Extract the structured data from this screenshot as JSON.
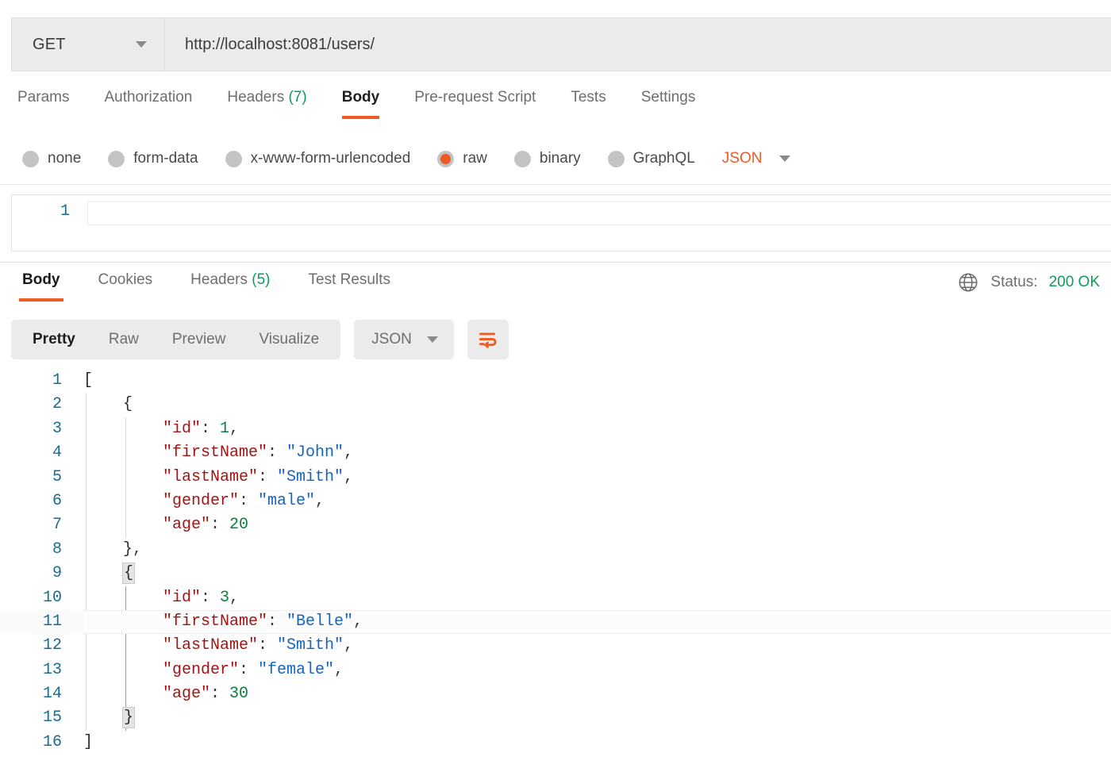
{
  "request": {
    "method": "GET",
    "method_caret_icon": "chevron-down-icon",
    "url": "http://localhost:8081/users/",
    "tabs": [
      {
        "label": "Params",
        "active": false
      },
      {
        "label": "Authorization",
        "active": false
      },
      {
        "label": "Headers",
        "count": "(7)",
        "active": false
      },
      {
        "label": "Body",
        "active": true
      },
      {
        "label": "Pre-request Script",
        "active": false
      },
      {
        "label": "Tests",
        "active": false
      },
      {
        "label": "Settings",
        "active": false
      }
    ],
    "body_types": [
      {
        "label": "none",
        "checked": false
      },
      {
        "label": "form-data",
        "checked": false
      },
      {
        "label": "x-www-form-urlencoded",
        "checked": false
      },
      {
        "label": "raw",
        "checked": true
      },
      {
        "label": "binary",
        "checked": false
      },
      {
        "label": "GraphQL",
        "checked": false
      }
    ],
    "raw_format": "JSON",
    "raw_format_caret_icon": "chevron-down-icon",
    "editor": {
      "line_number": "1",
      "value": "",
      "placeholder": ""
    }
  },
  "response": {
    "tabs": [
      {
        "label": "Body",
        "active": true
      },
      {
        "label": "Cookies",
        "active": false
      },
      {
        "label": "Headers",
        "count": "(5)",
        "active": false
      },
      {
        "label": "Test Results",
        "active": false
      }
    ],
    "globe_icon": "globe-icon",
    "status_label": "Status:",
    "status_value": "200 OK",
    "toolbar": {
      "views": [
        {
          "label": "Pretty",
          "active": true
        },
        {
          "label": "Raw",
          "active": false
        },
        {
          "label": "Preview",
          "active": false
        },
        {
          "label": "Visualize",
          "active": false
        }
      ],
      "format": "JSON",
      "format_caret_icon": "chevron-down-icon",
      "wrap_icon": "word-wrap-icon"
    },
    "body_lines": [
      {
        "n": "1",
        "indent": 0,
        "tokens": [
          {
            "t": "brace",
            "v": "["
          }
        ]
      },
      {
        "n": "2",
        "indent": 1,
        "tokens": [
          {
            "t": "brace",
            "v": "{"
          }
        ]
      },
      {
        "n": "3",
        "indent": 2,
        "tokens": [
          {
            "t": "key",
            "v": "\"id\""
          },
          {
            "t": "punc",
            "v": ": "
          },
          {
            "t": "num",
            "v": "1"
          },
          {
            "t": "punc",
            "v": ","
          }
        ]
      },
      {
        "n": "4",
        "indent": 2,
        "tokens": [
          {
            "t": "key",
            "v": "\"firstName\""
          },
          {
            "t": "punc",
            "v": ": "
          },
          {
            "t": "str",
            "v": "\"John\""
          },
          {
            "t": "punc",
            "v": ","
          }
        ]
      },
      {
        "n": "5",
        "indent": 2,
        "tokens": [
          {
            "t": "key",
            "v": "\"lastName\""
          },
          {
            "t": "punc",
            "v": ": "
          },
          {
            "t": "str",
            "v": "\"Smith\""
          },
          {
            "t": "punc",
            "v": ","
          }
        ]
      },
      {
        "n": "6",
        "indent": 2,
        "tokens": [
          {
            "t": "key",
            "v": "\"gender\""
          },
          {
            "t": "punc",
            "v": ": "
          },
          {
            "t": "str",
            "v": "\"male\""
          },
          {
            "t": "punc",
            "v": ","
          }
        ]
      },
      {
        "n": "7",
        "indent": 2,
        "tokens": [
          {
            "t": "key",
            "v": "\"age\""
          },
          {
            "t": "punc",
            "v": ": "
          },
          {
            "t": "num",
            "v": "20"
          }
        ]
      },
      {
        "n": "8",
        "indent": 1,
        "tokens": [
          {
            "t": "brace",
            "v": "}"
          },
          {
            "t": "punc",
            "v": ","
          }
        ]
      },
      {
        "n": "9",
        "indent": 1,
        "tokens": [
          {
            "t": "brace-match",
            "v": "{"
          }
        ]
      },
      {
        "n": "10",
        "indent": 2,
        "tokens": [
          {
            "t": "key",
            "v": "\"id\""
          },
          {
            "t": "punc",
            "v": ": "
          },
          {
            "t": "num",
            "v": "3"
          },
          {
            "t": "punc",
            "v": ","
          }
        ]
      },
      {
        "n": "11",
        "indent": 2,
        "active": true,
        "tokens": [
          {
            "t": "key",
            "v": "\"firstName\""
          },
          {
            "t": "punc",
            "v": ": "
          },
          {
            "t": "str",
            "v": "\"Belle\""
          },
          {
            "t": "punc",
            "v": ","
          }
        ]
      },
      {
        "n": "12",
        "indent": 2,
        "tokens": [
          {
            "t": "key",
            "v": "\"lastName\""
          },
          {
            "t": "punc",
            "v": ": "
          },
          {
            "t": "str",
            "v": "\"Smith\""
          },
          {
            "t": "punc",
            "v": ","
          }
        ]
      },
      {
        "n": "13",
        "indent": 2,
        "tokens": [
          {
            "t": "key",
            "v": "\"gender\""
          },
          {
            "t": "punc",
            "v": ": "
          },
          {
            "t": "str",
            "v": "\"female\""
          },
          {
            "t": "punc",
            "v": ","
          }
        ]
      },
      {
        "n": "14",
        "indent": 2,
        "tokens": [
          {
            "t": "key",
            "v": "\"age\""
          },
          {
            "t": "punc",
            "v": ": "
          },
          {
            "t": "num",
            "v": "30"
          }
        ]
      },
      {
        "n": "15",
        "indent": 1,
        "tokens": [
          {
            "t": "brace-match",
            "v": "}"
          }
        ]
      },
      {
        "n": "16",
        "indent": 0,
        "tokens": [
          {
            "t": "brace",
            "v": "]"
          }
        ]
      }
    ]
  },
  "colors": {
    "accent": "#ef5b25",
    "success": "#0f9b5a",
    "json_key": "#a31515",
    "json_string": "#1565c0",
    "json_number": "#0b8043",
    "line_number": "#1a6b8f",
    "toolbar_bg": "#ebebeb"
  }
}
